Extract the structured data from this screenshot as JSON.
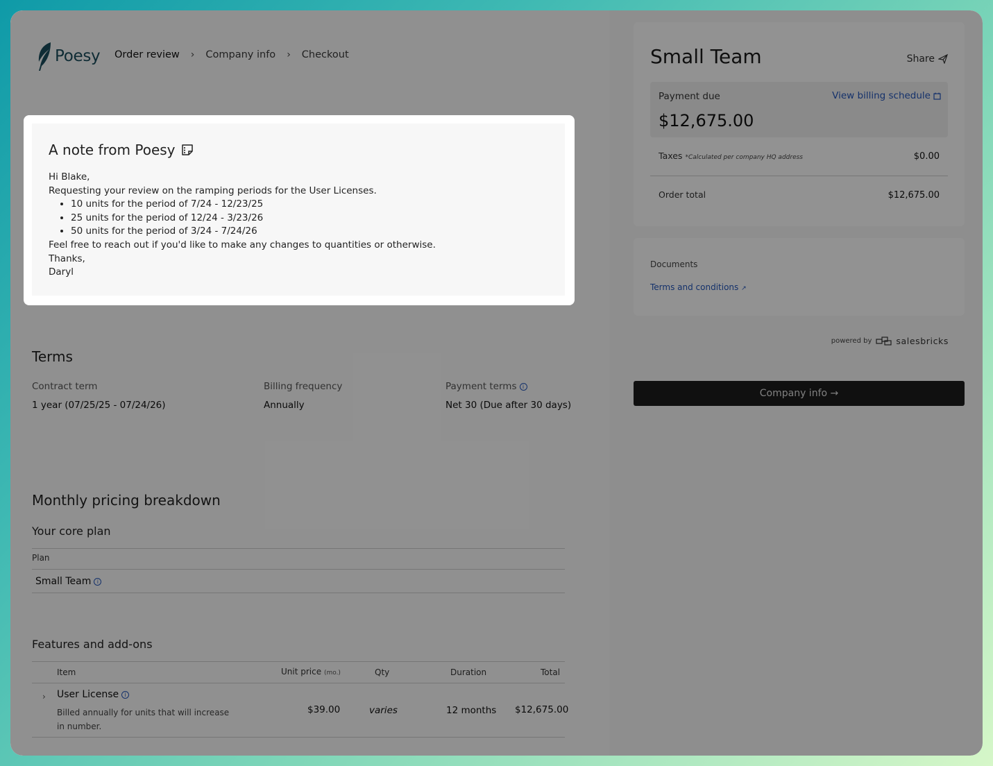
{
  "brand": {
    "name": "Poesy"
  },
  "breadcrumb": {
    "items": [
      "Order review",
      "Company info",
      "Checkout"
    ],
    "separator": "›"
  },
  "note": {
    "title": "A note from Poesy",
    "greeting": "Hi Blake,",
    "intro": "Requesting your review on the ramping periods for the User Licenses.",
    "bullets": [
      "10 units for the period of 7/24 - 12/23/25",
      "25 units for the period of 12/24 - 3/23/26",
      "50 units for the period of 3/24 - 7/24/26"
    ],
    "closing": "Feel free to reach out if you'd like to make any changes to quantities or otherwise.",
    "signoff": "Thanks,",
    "signature": "Daryl"
  },
  "terms": {
    "title": "Terms",
    "contract_term_label": "Contract term",
    "contract_term_value": "1 year (07/25/25 - 07/24/26)",
    "billing_frequency_label": "Billing frequency",
    "billing_frequency_value": "Annually",
    "payment_terms_label": "Payment terms",
    "payment_terms_value": "Net 30 (Due after 30 days)"
  },
  "pricing": {
    "title": "Monthly pricing breakdown",
    "core_plan_title": "Your core plan",
    "plan_col": "Plan",
    "plan_value": "Small Team",
    "addons_title": "Features and add-ons",
    "cols": {
      "item": "Item",
      "unit_price": "Unit price",
      "unit_price_suffix": "(mo.)",
      "qty": "Qty",
      "duration": "Duration",
      "total": "Total"
    },
    "rows": [
      {
        "item": "User License",
        "description": "Billed annually for units that will increase in number.",
        "unit_price": "$39.00",
        "qty": "varies",
        "duration": "12 months",
        "total": "$12,675.00"
      }
    ]
  },
  "summary": {
    "plan_title": "Small Team",
    "share_label": "Share",
    "payment_due_label": "Payment due",
    "billing_link": "View billing schedule",
    "payment_due_amount": "$12,675.00",
    "taxes_label": "Taxes",
    "taxes_note": "*Calculated per company HQ address",
    "taxes_value": "$0.00",
    "order_total_label": "Order total",
    "order_total_value": "$12,675.00"
  },
  "documents": {
    "label": "Documents",
    "terms_link": "Terms and conditions"
  },
  "powered_by": {
    "prefix": "powered by",
    "brand": "salesbricks"
  },
  "cta": {
    "label": "Company info →"
  },
  "colors": {
    "link": "#2455b8",
    "cta_bg": "#1c1c1c",
    "brand": "#1a4d5c"
  }
}
